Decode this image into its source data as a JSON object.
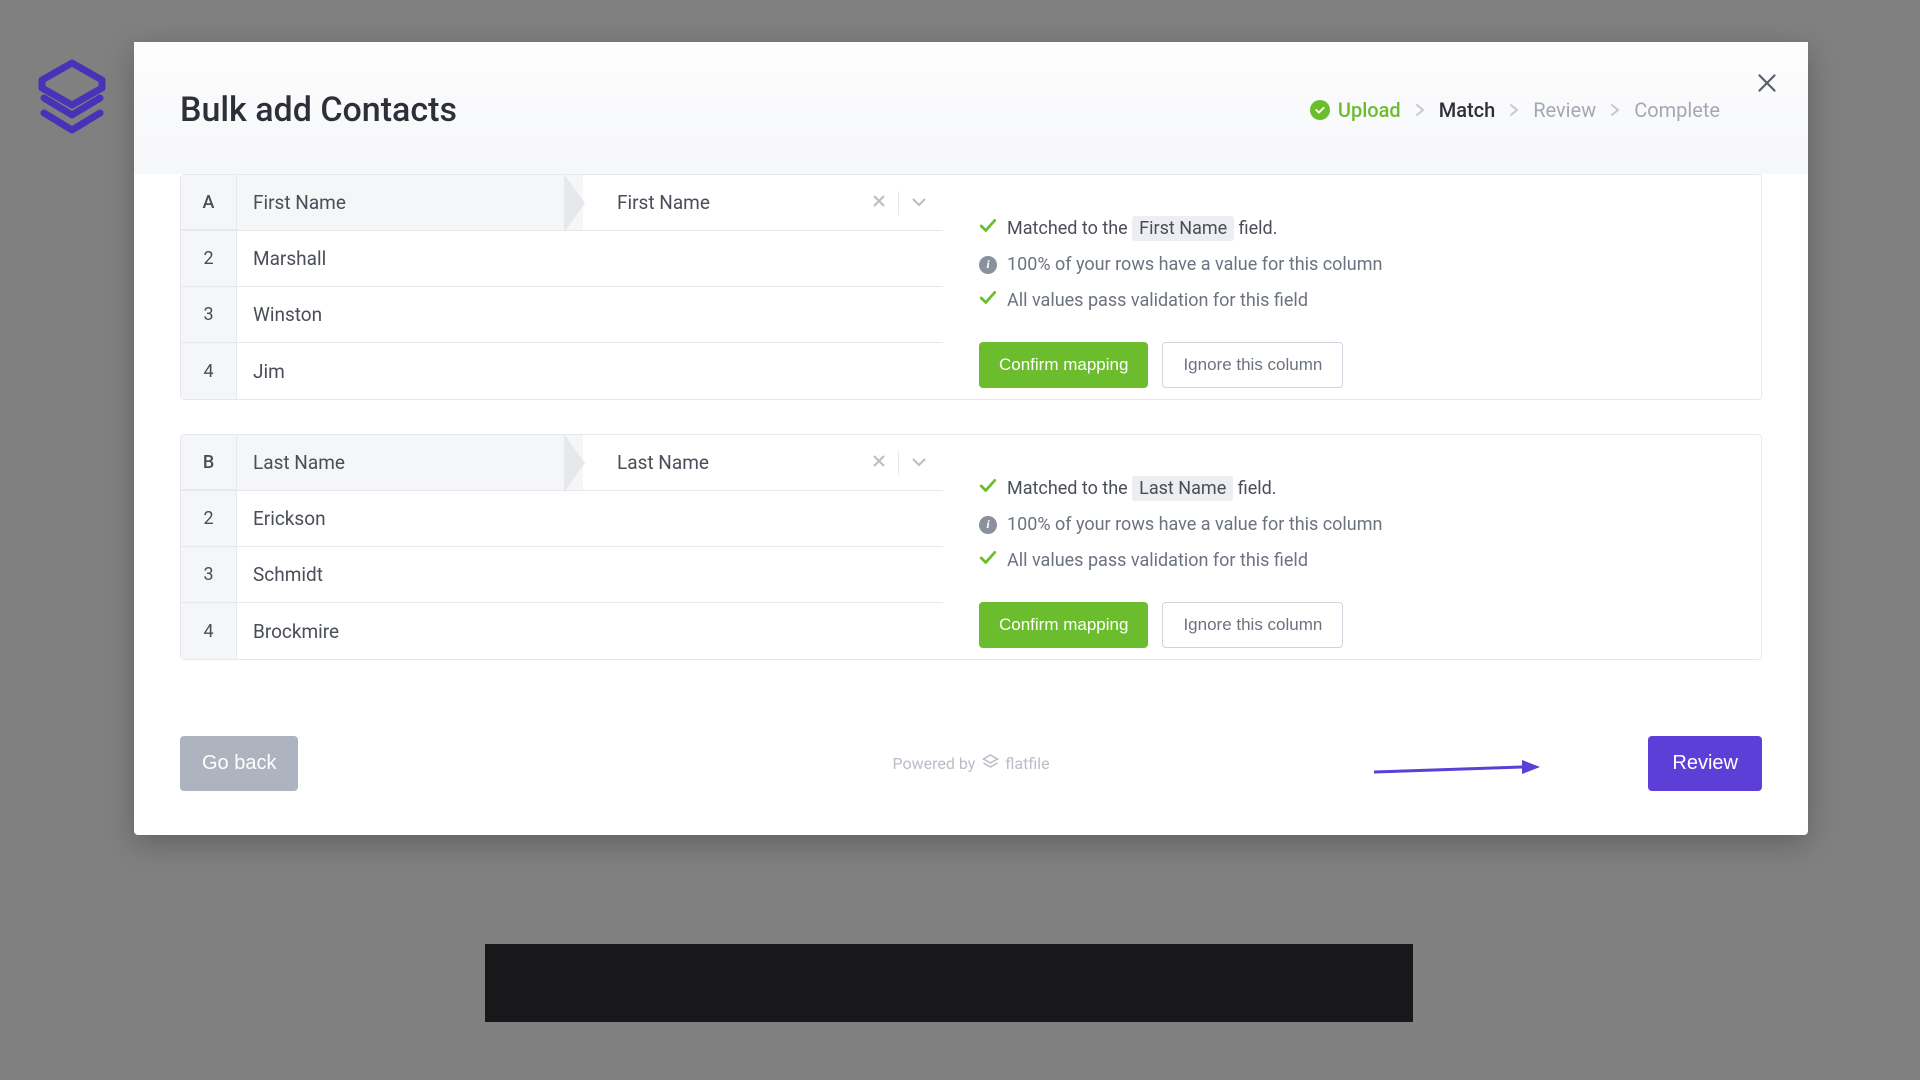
{
  "modal": {
    "title": "Bulk add Contacts",
    "close_label": "Close"
  },
  "steps": [
    {
      "label": "Upload",
      "state": "completed"
    },
    {
      "label": "Match",
      "state": "active"
    },
    {
      "label": "Review",
      "state": "inactive"
    },
    {
      "label": "Complete",
      "state": "inactive"
    }
  ],
  "mappings": [
    {
      "col_letter": "A",
      "source_name": "First Name",
      "target_name": "First Name",
      "rows": [
        {
          "n": "2",
          "v": "Marshall"
        },
        {
          "n": "3",
          "v": "Winston"
        },
        {
          "n": "4",
          "v": "Jim"
        }
      ],
      "matched_prefix": "Matched to the",
      "matched_field": "First Name",
      "matched_suffix": "field.",
      "coverage": "100% of your rows have a value for this column",
      "validation": "All values pass validation for this field",
      "confirm_label": "Confirm mapping",
      "ignore_label": "Ignore this column"
    },
    {
      "col_letter": "B",
      "source_name": "Last Name",
      "target_name": "Last Name",
      "rows": [
        {
          "n": "2",
          "v": "Erickson"
        },
        {
          "n": "3",
          "v": "Schmidt"
        },
        {
          "n": "4",
          "v": "Brockmire"
        }
      ],
      "matched_prefix": "Matched to the",
      "matched_field": "Last Name",
      "matched_suffix": "field.",
      "coverage": "100% of your rows have a value for this column",
      "validation": "All values pass validation for this field",
      "confirm_label": "Confirm mapping",
      "ignore_label": "Ignore this column"
    }
  ],
  "footer": {
    "back_label": "Go back",
    "review_label": "Review",
    "powered_prefix": "Powered by",
    "powered_brand": "flatfile"
  }
}
